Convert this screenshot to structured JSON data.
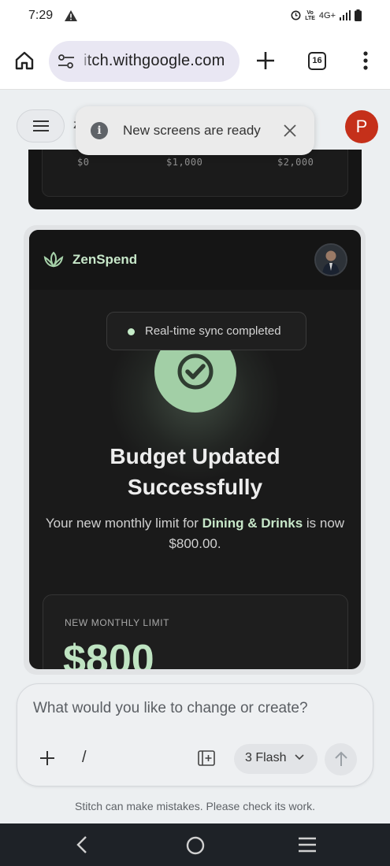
{
  "status_bar": {
    "time": "7:29",
    "network": "4G+"
  },
  "browser": {
    "url": "itch.withgoogle.com",
    "tab_count": "16"
  },
  "page_header": {
    "partial_title": "z",
    "avatar_letter": "P"
  },
  "toast": {
    "message": "New screens are ready"
  },
  "chart_card": {
    "ticks": [
      "$0",
      "$1,000",
      "$2,000"
    ]
  },
  "app_screen": {
    "brand": "ZenSpend",
    "sync_status": "Real-time sync completed",
    "headline_line1": "Budget Updated",
    "headline_line2": "Successfully",
    "desc_prefix": "Your new monthly limit for ",
    "desc_category": "Dining & Drinks",
    "desc_suffix": " is now $800.00.",
    "limit_label": "NEW MONTHLY LIMIT",
    "limit_amount": "$800",
    "accent_color": "#c7e7c9"
  },
  "prompt": {
    "placeholder": "What would you like to change or create?",
    "slash": "/",
    "model": "3 Flash"
  },
  "disclaimer": "Stitch can make mistakes. Please check its work."
}
